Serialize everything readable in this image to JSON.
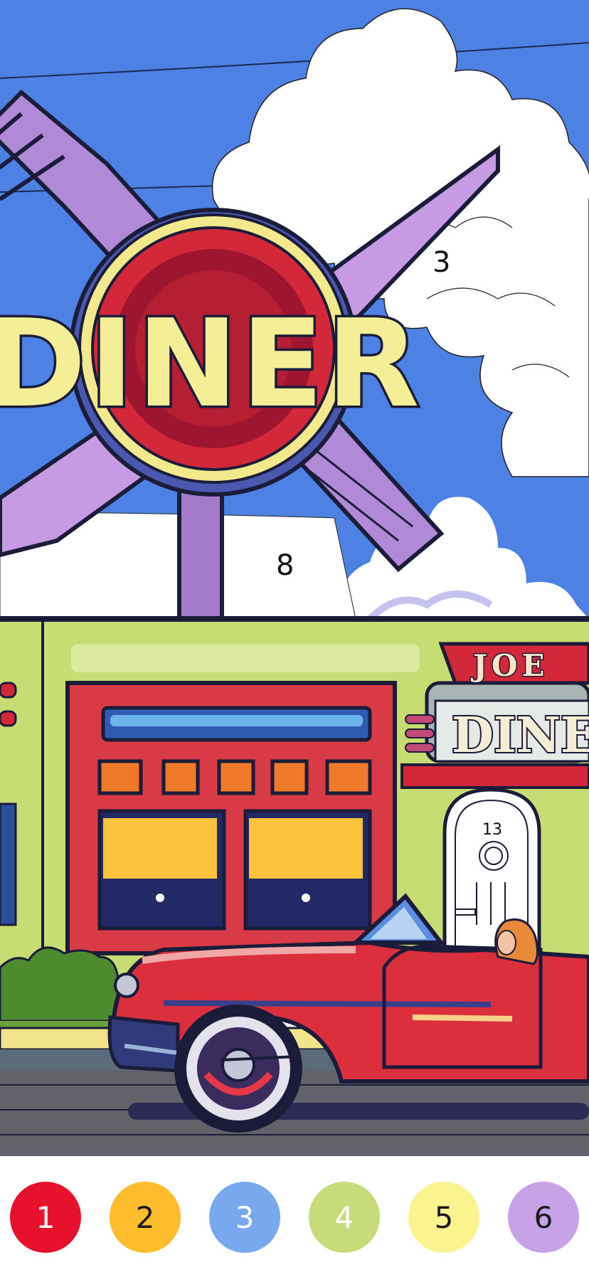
{
  "scene": {
    "sign_text": "DINER",
    "facade_sign_top": "JOE",
    "facade_sign_bottom": "DINE",
    "region_numbers": {
      "cloud_right": "3",
      "sky_under_sign": "8",
      "door": "13"
    }
  },
  "palette": {
    "colors": [
      {
        "number": "1",
        "hex": "#e8112d",
        "text_color": "#ffffff"
      },
      {
        "number": "2",
        "hex": "#fdbc2b",
        "text_color": "#1a1a1a"
      },
      {
        "number": "3",
        "hex": "#7aa8ef",
        "text_color": "#ffffff"
      },
      {
        "number": "4",
        "hex": "#c7db7a",
        "text_color": "#ffffff"
      },
      {
        "number": "5",
        "hex": "#fbf38e",
        "text_color": "#1a1a1a"
      },
      {
        "number": "6",
        "hex": "#c8a2e6",
        "text_color": "#1a1a1a"
      }
    ]
  }
}
